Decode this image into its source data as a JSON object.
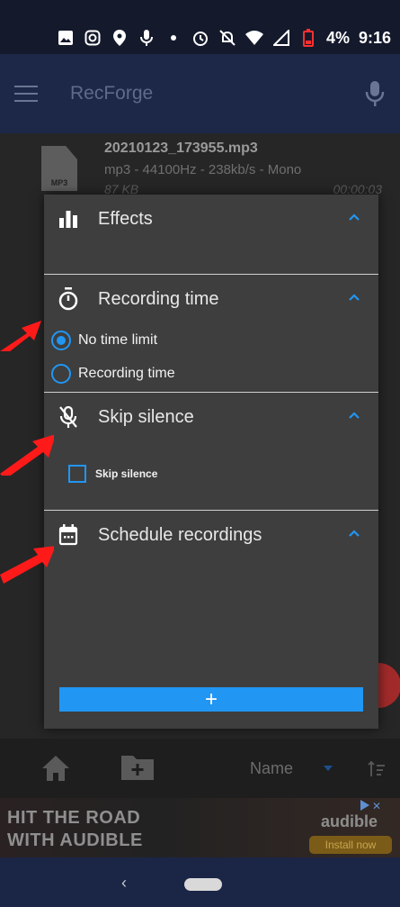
{
  "status_bar": {
    "battery": "4%",
    "time": "9:16",
    "icons": [
      "image-icon",
      "instagram-icon",
      "location-icon",
      "mic-small-icon",
      "dot-icon",
      "alarm-icon",
      "notifications-off-icon",
      "wifi-icon",
      "signal-icon",
      "battery-icon"
    ]
  },
  "app_bar": {
    "title": "RecForge",
    "menu_icon": "hamburger-menu-icon",
    "action_icon": "microphone-icon"
  },
  "file": {
    "badge": "MP3",
    "name": "20210123_173955.mp3",
    "meta": "mp3 - 44100Hz - 238kb/s - Mono",
    "size": "87 KB",
    "duration": "00:00:03"
  },
  "sheet": {
    "sections": [
      {
        "title": "Effects",
        "icon": "bar-chart-icon"
      },
      {
        "title": "Recording time",
        "icon": "stopwatch-icon"
      },
      {
        "title": "Skip silence",
        "icon": "mic-off-icon"
      },
      {
        "title": "Schedule recordings",
        "icon": "calendar-icon"
      }
    ],
    "recording_time_options": [
      {
        "label": "No time limit",
        "selected": true
      },
      {
        "label": "Recording time",
        "selected": false
      }
    ],
    "skip_silence_checkbox": {
      "label": "Skip silence",
      "checked": false
    },
    "add_button_label": "+"
  },
  "bottom_toolbar": {
    "sort_label": "Name",
    "icons": [
      "home-icon",
      "new-folder-icon",
      "sort-icon"
    ]
  },
  "ad": {
    "title_line1": "HIT THE ROAD",
    "title_line2": "WITH AUDIBLE",
    "brand": "audible",
    "cta": "Install now"
  },
  "nav_bar": {
    "back": "‹"
  },
  "colors": {
    "accent": "#2196f3",
    "app_bar": "#1d2747",
    "sheet_bg": "#3e3e3e",
    "annotation_arrow": "#ff1a1a"
  }
}
